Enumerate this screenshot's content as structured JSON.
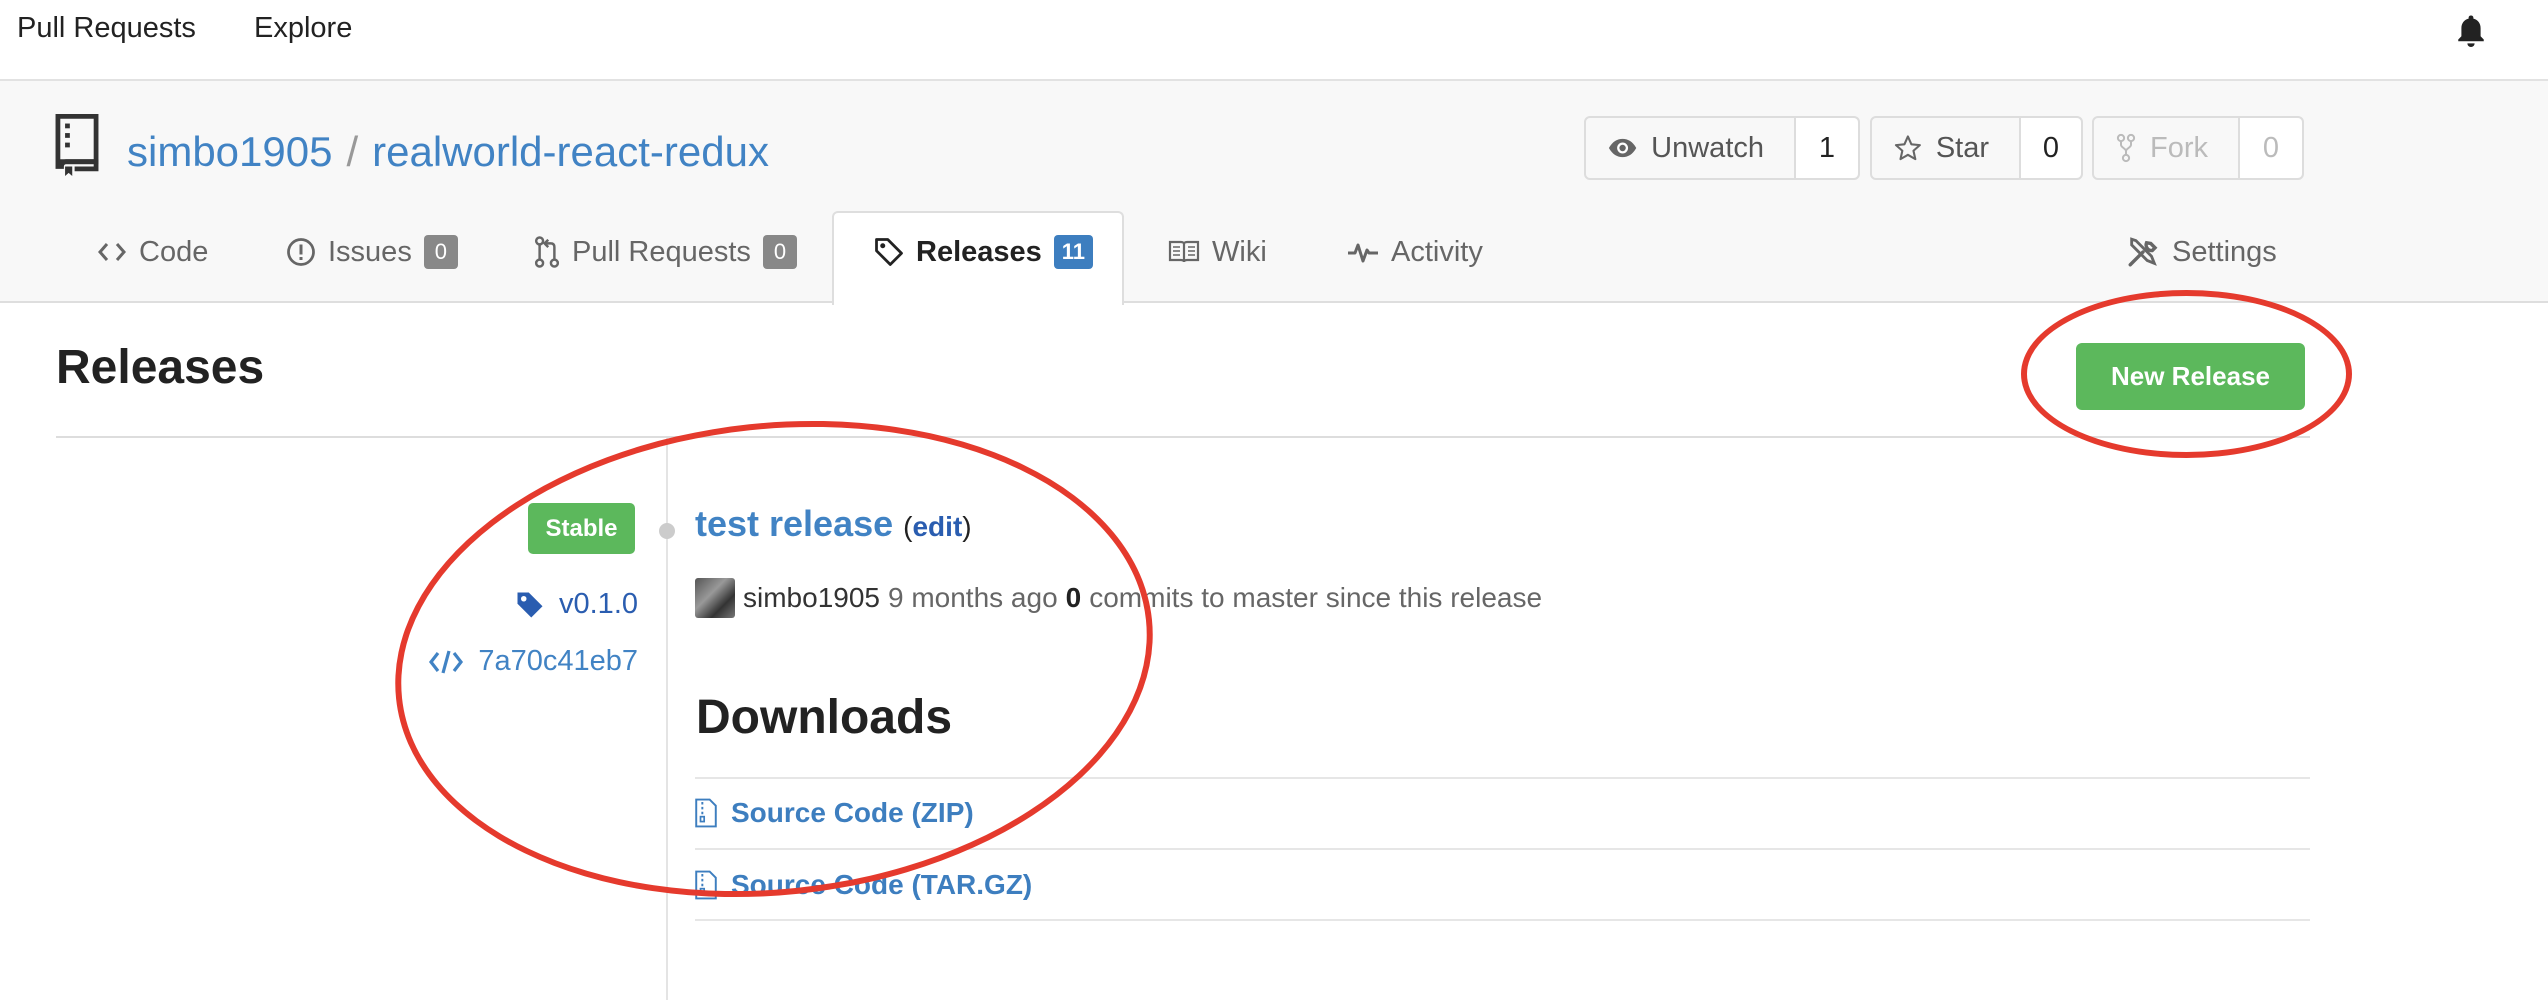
{
  "topnav": {
    "pull_requests": "Pull Requests",
    "explore": "Explore"
  },
  "repo": {
    "owner": "simbo1905",
    "separator": "/",
    "name": "realworld-react-redux",
    "watch_label": "Unwatch",
    "watch_count": "1",
    "star_label": "Star",
    "star_count": "0",
    "fork_label": "Fork",
    "fork_count": "0"
  },
  "tabs": [
    {
      "label": "Code"
    },
    {
      "label": "Issues",
      "badge": "0"
    },
    {
      "label": "Pull Requests",
      "badge": "0"
    },
    {
      "label": "Releases",
      "badge": "11",
      "active": true
    },
    {
      "label": "Wiki"
    },
    {
      "label": "Activity"
    },
    {
      "label": "Settings"
    }
  ],
  "page": {
    "title": "Releases",
    "new_release": "New Release"
  },
  "release": {
    "status": "Stable",
    "tag": "v0.1.0",
    "commit": "7a70c41eb7",
    "title": "test release",
    "edit_open": "(",
    "edit": "edit",
    "edit_close": ")",
    "author": "simbo1905",
    "time": "9 months ago",
    "commit_count": "0",
    "commits_text": "commits to master since this release"
  },
  "downloads": {
    "title": "Downloads",
    "items": [
      "Source Code (ZIP)",
      "Source Code (TAR.GZ)"
    ]
  },
  "colors": {
    "accent": "#4183c4",
    "success": "#5cb85c",
    "annotation": "#e53a2d"
  }
}
